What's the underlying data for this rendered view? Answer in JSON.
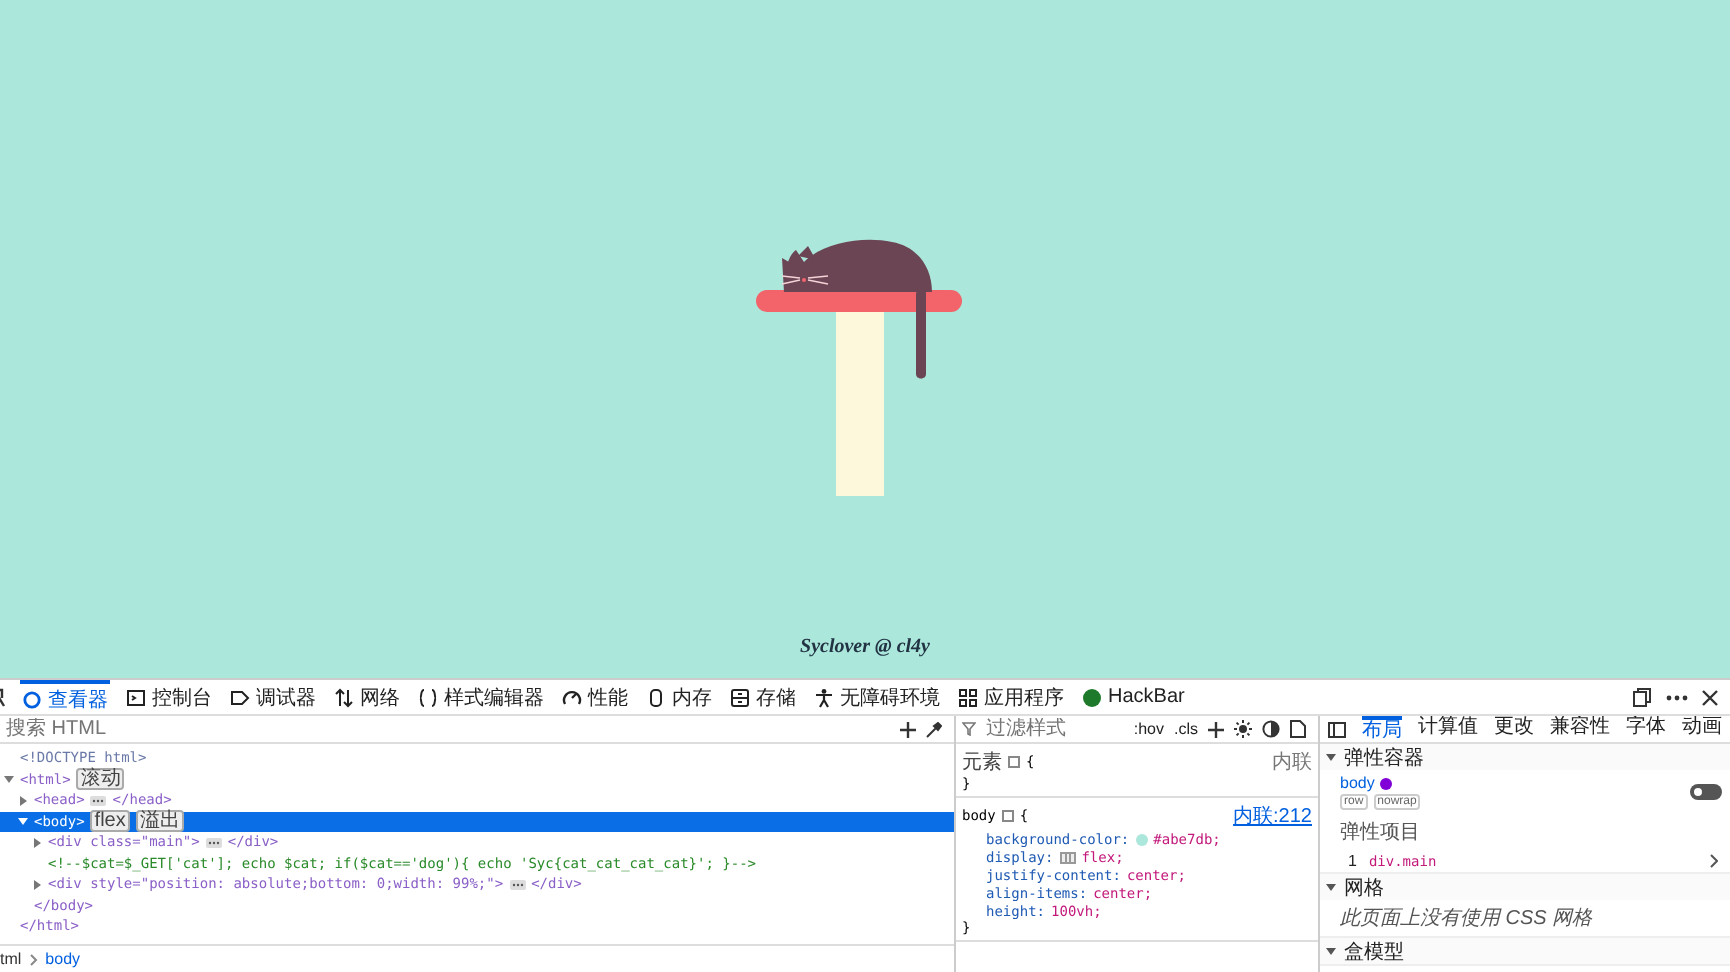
{
  "page": {
    "caption": "Syclover @ cl4y"
  },
  "devtools": {
    "tabs": [
      {
        "label": "查看器",
        "selected": true
      },
      {
        "label": "控制台",
        "selected": false
      },
      {
        "label": "调试器",
        "selected": false
      },
      {
        "label": "网络",
        "selected": false
      },
      {
        "label": "样式编辑器",
        "selected": false
      },
      {
        "label": "性能",
        "selected": false
      },
      {
        "label": "内存",
        "selected": false
      },
      {
        "label": "存储",
        "selected": false
      },
      {
        "label": "无障碍环境",
        "selected": false
      },
      {
        "label": "应用程序",
        "selected": false
      },
      {
        "label": "HackBar",
        "selected": false
      }
    ],
    "inspector": {
      "search": {
        "placeholder": "搜索 HTML"
      },
      "tree": [
        {
          "kind": "doctype",
          "open": "<!DOCTYPE html>"
        },
        {
          "kind": "element",
          "open": "<html>",
          "close": "</html>",
          "expanded": true,
          "selected": false,
          "badges": [
            "滚动"
          ],
          "children": [
            {
              "kind": "element",
              "open": "<head>",
              "close": "</head>",
              "expanded": false,
              "selected": false
            },
            {
              "kind": "element",
              "open": "<body>",
              "close": "</body>",
              "expanded": true,
              "selected": true,
              "badges": [
                "flex",
                "溢出"
              ],
              "children": [
                {
                  "kind": "element",
                  "open": "<div class=\"main\">",
                  "close": "</div>",
                  "expanded": false,
                  "selected": false
                },
                {
                  "kind": "comment",
                  "open": "<!--$cat=$_GET['cat']; echo $cat; if($cat=='dog'){ echo 'Syc{cat_cat_cat_cat}'; }-->"
                },
                {
                  "kind": "element",
                  "open": "<div style=\"position: absolute;bottom: 0;width: 99%;\">",
                  "close": "</div>",
                  "expanded": false,
                  "selected": false
                }
              ]
            }
          ]
        }
      ],
      "breadcrumb": [
        "tml",
        "body"
      ]
    },
    "rules": {
      "filter": {
        "placeholder": "过滤样式"
      },
      "hov": ":hov",
      "cls": ".cls",
      "element_rule": {
        "selector": "元素",
        "open": "{",
        "close": "}",
        "source": "内联"
      },
      "body_rule": {
        "selector": "body",
        "open": "{",
        "close": "}",
        "source": "内联:212",
        "declarations": [
          {
            "name": "background-color:",
            "value": "#abe7db;",
            "color": "#abe7db"
          },
          {
            "name": "display:",
            "value": "flex;",
            "kind": "flex"
          },
          {
            "name": "justify-content:",
            "value": "center;"
          },
          {
            "name": "align-items:",
            "value": "center;"
          },
          {
            "name": "height:",
            "value": "100vh;"
          }
        ]
      }
    },
    "layout": {
      "tabs": [
        {
          "label": "布局",
          "selected": true
        },
        {
          "label": "计算值",
          "selected": false
        },
        {
          "label": "更改",
          "selected": false
        },
        {
          "label": "兼容性",
          "selected": false
        },
        {
          "label": "字体",
          "selected": false
        },
        {
          "label": "动画",
          "selected": false
        }
      ],
      "sections": [
        {
          "kind": "flex",
          "title": "弹性容器",
          "expanded": true,
          "element": "body",
          "badges": [
            "row",
            "nowrap"
          ],
          "overlay_on": false,
          "items_title": "弹性项目",
          "items": [
            {
              "index": "1",
              "label": "div.main"
            }
          ]
        },
        {
          "kind": "grid",
          "title": "网格",
          "expanded": true,
          "message": "此页面上没有使用 CSS 网格"
        },
        {
          "kind": "box",
          "title": "盒模型",
          "expanded": true
        }
      ]
    }
  }
}
